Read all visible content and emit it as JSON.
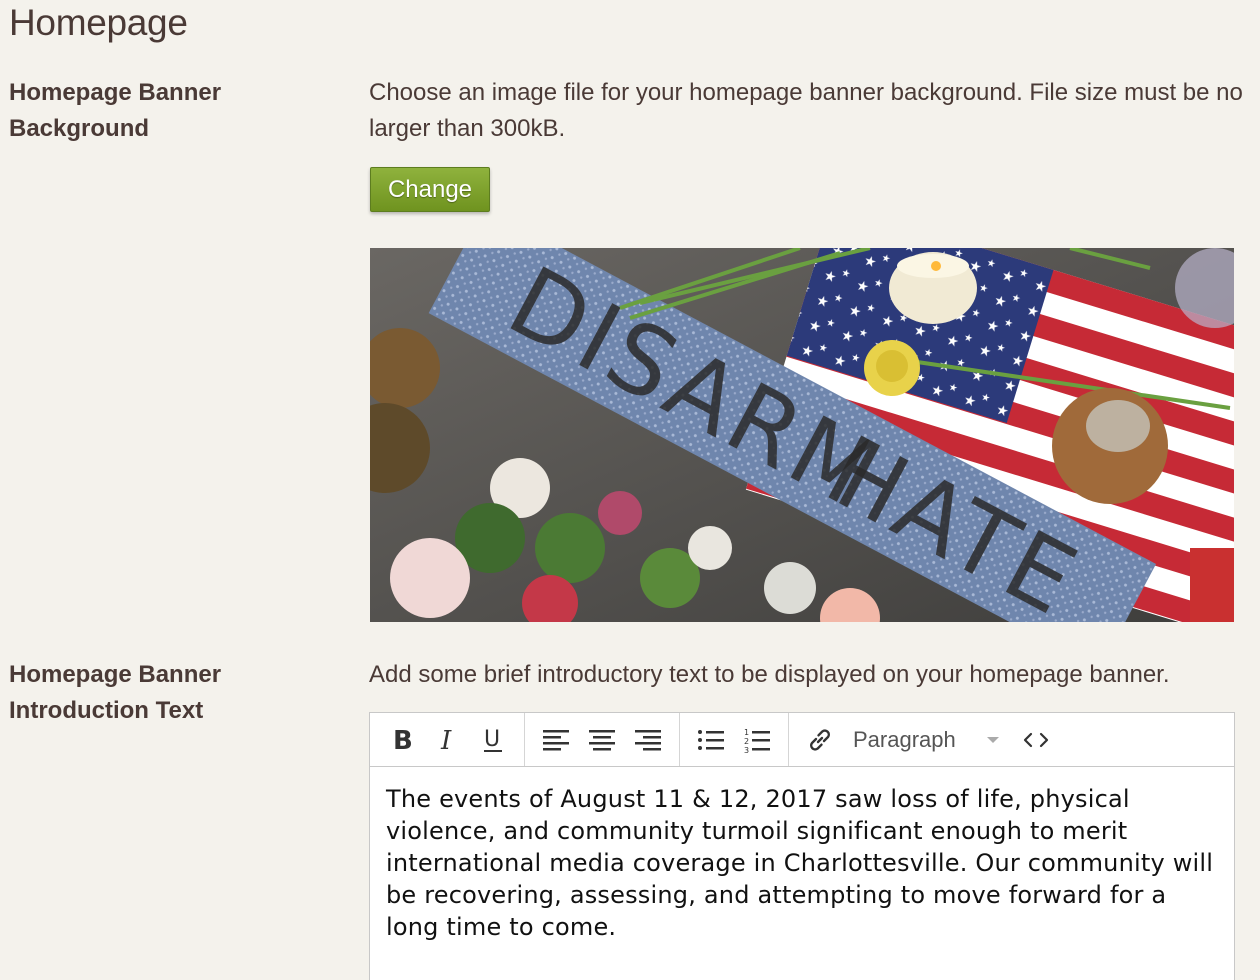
{
  "page": {
    "title": "Homepage"
  },
  "banner_background": {
    "label": "Homepage Banner Background",
    "description": "Choose an image file for your homepage banner background. File size must be no larger than 300kB.",
    "change_label": "Change",
    "image": {
      "banner_word_1": "DISARM",
      "banner_word_2": "HATE"
    }
  },
  "intro_text": {
    "label": "Homepage Banner Introduction Text",
    "description": "Add some brief introductory text to be displayed on your homepage banner.",
    "toolbar": {
      "bold_icon": "bold-icon",
      "italic_icon": "italic-icon",
      "underline_icon": "underline-icon",
      "align_left_icon": "align-left-icon",
      "align_center_icon": "align-center-icon",
      "align_right_icon": "align-right-icon",
      "bullet_list_icon": "bullet-list-icon",
      "numbered_list_icon": "numbered-list-icon",
      "link_icon": "link-icon",
      "format_selected": "Paragraph",
      "code_icon": "code-icon"
    },
    "content": "The events of August 11 & 12, 2017 saw loss of life, physical violence, and community turmoil significant enough to merit international media coverage in Charlottesville. Our community will be recovering, assessing, and attempting to move forward for a long time to come."
  },
  "colors": {
    "page_background": "#f4f2ec",
    "text": "#4a3a36",
    "button_green": "#7aa02a"
  }
}
